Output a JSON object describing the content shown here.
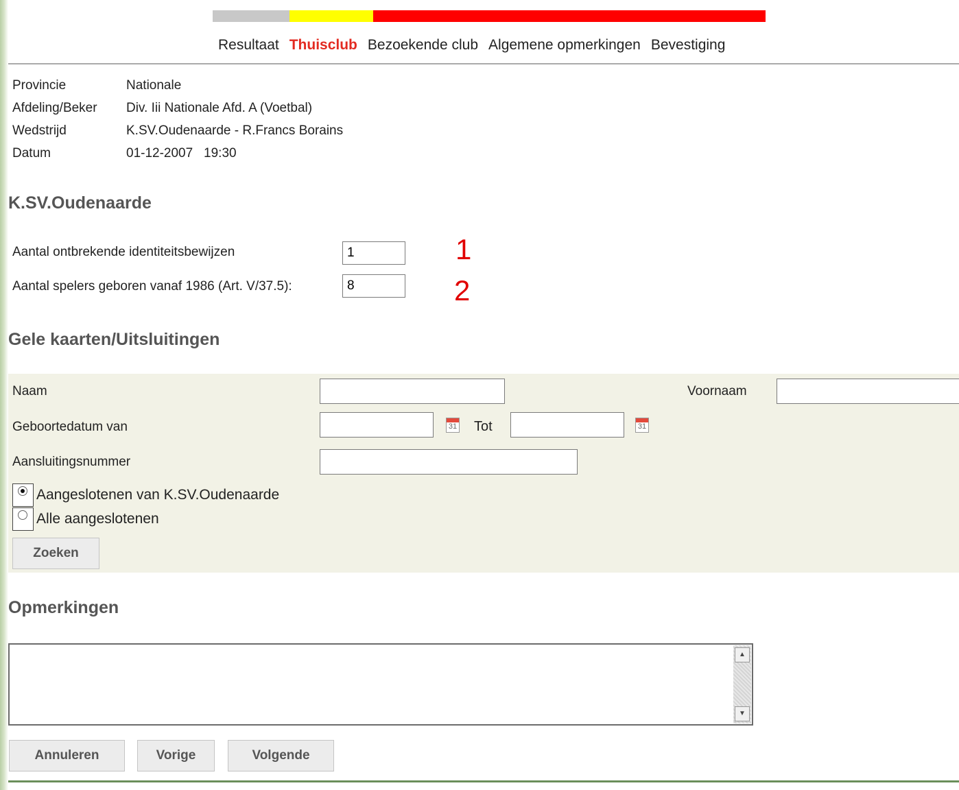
{
  "steps": [
    "Resultaat",
    "Thuisclub",
    "Bezoekende club",
    "Algemene opmerkingen",
    "Bevestiging"
  ],
  "active_step": "Thuisclub",
  "info": [
    {
      "label": "Provincie",
      "value": "Nationale"
    },
    {
      "label": "Afdeling/Beker",
      "value": "Div. Iii Nationale Afd. A (Voetbal)"
    },
    {
      "label": "Wedstrijd",
      "value": "K.SV.Oudenaarde - R.Francs Borains"
    },
    {
      "label": "Datum",
      "value": "01-12-2007   19:30"
    }
  ],
  "club_heading": "K.SV.Oudenaarde",
  "fields": {
    "missing_id_label": "Aantal ontbrekende identiteitsbewijzen",
    "missing_id_value": "1",
    "players_label": "Aantal spelers geboren vanaf 1986 (Art. V/37.5):",
    "players_value": "8"
  },
  "annotations": [
    "1",
    "2"
  ],
  "cards_heading": "Gele kaarten/Uitsluitingen",
  "search": {
    "naam_label": "Naam",
    "voornaam_label": "Voornaam",
    "geboortedatum_label": "Geboortedatum van",
    "tot_label": "Tot",
    "aansluiting_label": "Aansluitingsnummer",
    "radio_club": "Aangeslotenen van K.SV.Oudenaarde",
    "radio_all": "Alle aangeslotenen",
    "calendar_text": "31",
    "search_button": "Zoeken"
  },
  "remarks_heading": "Opmerkingen",
  "buttons": {
    "cancel": "Annuleren",
    "previous": "Vorige",
    "next": "Volgende"
  },
  "colors": {
    "accent_red": "#e32a21",
    "progress_grey": "#c8c8c8",
    "progress_yellow": "#ffff00",
    "progress_red": "#ff0000"
  }
}
